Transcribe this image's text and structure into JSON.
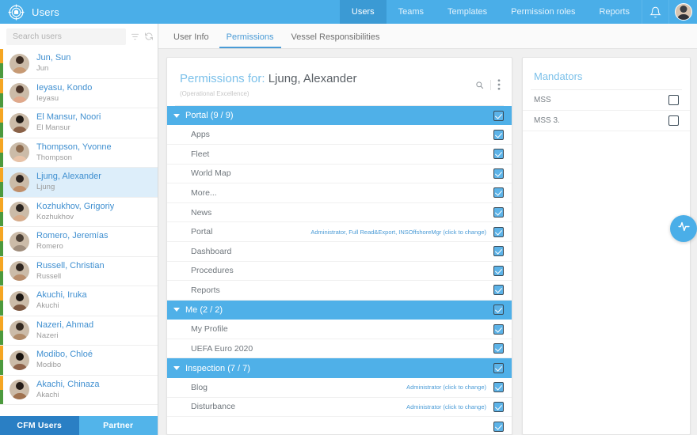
{
  "header": {
    "logo_icon": "compass-logo-icon",
    "title": "Users",
    "nav": [
      {
        "label": "Users",
        "active": true
      },
      {
        "label": "Teams",
        "active": false
      },
      {
        "label": "Templates",
        "active": false
      },
      {
        "label": "Permission roles",
        "active": false
      },
      {
        "label": "Reports",
        "active": false
      }
    ],
    "bell_icon": "notification-bell-icon",
    "avatar_icon": "user-avatar"
  },
  "sidebar": {
    "search": {
      "placeholder": "Search users",
      "value": ""
    },
    "tools": [
      {
        "icon": "filter-icon",
        "name": "filter-button"
      },
      {
        "icon": "refresh-icon",
        "name": "refresh-button"
      },
      {
        "icon": "plus-icon",
        "name": "add-user-button"
      }
    ],
    "users": [
      {
        "name": "Jun, Sun",
        "sub": "Jun",
        "selected": false,
        "skin": "#c79a74",
        "hair": "#3a2b22"
      },
      {
        "name": "Ieyasu, Kondo",
        "sub": "Ieyasu",
        "selected": false,
        "skin": "#e0a98c",
        "hair": "#4a352a"
      },
      {
        "name": "El Mansur, Noori",
        "sub": "El Mansur",
        "selected": false,
        "skin": "#8a6248",
        "hair": "#1f1a16"
      },
      {
        "name": "Thompson, Yvonne",
        "sub": "Thompson",
        "selected": false,
        "skin": "#e8c3a8",
        "hair": "#8c6b4f"
      },
      {
        "name": "Ljung, Alexander",
        "sub": "Ljung",
        "selected": true,
        "skin": "#c08f6a",
        "hair": "#2b2320"
      },
      {
        "name": "Kozhukhov, Grigoriy",
        "sub": "Kozhukhov",
        "selected": false,
        "skin": "#d7ac8b",
        "hair": "#2a2420"
      },
      {
        "name": "Romero, Jeremías",
        "sub": "Romero",
        "selected": false,
        "skin": "#9f8d7c",
        "hair": "#4b4036"
      },
      {
        "name": "Russell, Christian",
        "sub": "Russell",
        "selected": false,
        "skin": "#b98e6c",
        "hair": "#2f2620"
      },
      {
        "name": "Akuchi, Iruka",
        "sub": "Akuchi",
        "selected": false,
        "skin": "#7c5740",
        "hair": "#1b1613"
      },
      {
        "name": "Nazeri, Ahmad",
        "sub": "Nazeri",
        "selected": false,
        "skin": "#b08a68",
        "hair": "#342a22"
      },
      {
        "name": "Modibo, Chloé",
        "sub": "Modibo",
        "selected": false,
        "skin": "#8e6249",
        "hair": "#17120f"
      },
      {
        "name": "Akachi, Chinaza",
        "sub": "Akachi",
        "selected": false,
        "skin": "#a0724f",
        "hair": "#241c17"
      }
    ],
    "bottom_tabs": [
      {
        "label": "CFM Users",
        "active": true
      },
      {
        "label": "Partner",
        "active": false
      }
    ]
  },
  "content": {
    "tabs": [
      {
        "label": "User Info",
        "active": false
      },
      {
        "label": "Permissions",
        "active": true
      },
      {
        "label": "Vessel Responsibilities",
        "active": false
      }
    ],
    "permissions_panel": {
      "title_prefix": "Permissions for:",
      "title_user": "Ljung, Alexander",
      "subtitle": "(Operational Excellence)",
      "search_icon": "search-icon",
      "menu_icon": "kebab-menu-icon",
      "groups": [
        {
          "label": "Portal (9 / 9)",
          "checked": true,
          "expanded": true,
          "items": [
            {
              "label": "Apps",
              "note": "",
              "checked": true
            },
            {
              "label": "Fleet",
              "note": "",
              "checked": true
            },
            {
              "label": "World Map",
              "note": "",
              "checked": true
            },
            {
              "label": "More...",
              "note": "",
              "checked": true
            },
            {
              "label": "News",
              "note": "",
              "checked": true
            },
            {
              "label": "Portal",
              "note": "Administrator, Full Read&Export, INSOffshoreMgr (click to change)",
              "checked": true
            },
            {
              "label": "Dashboard",
              "note": "",
              "checked": true
            },
            {
              "label": "Procedures",
              "note": "",
              "checked": true
            },
            {
              "label": "Reports",
              "note": "",
              "checked": true
            }
          ]
        },
        {
          "label": "Me (2 / 2)",
          "checked": true,
          "expanded": true,
          "items": [
            {
              "label": "My Profile",
              "note": "",
              "checked": true
            },
            {
              "label": "UEFA Euro 2020",
              "note": "",
              "checked": true
            }
          ]
        },
        {
          "label": "Inspection (7 / 7)",
          "checked": true,
          "expanded": true,
          "items": [
            {
              "label": "Blog",
              "note": "Administrator (click to change)",
              "checked": true
            },
            {
              "label": "Disturbance",
              "note": "Administrator (click to change)",
              "checked": true
            }
          ]
        }
      ]
    },
    "mandators_panel": {
      "title": "Mandators",
      "rows": [
        {
          "label": "MSS",
          "checked": false
        },
        {
          "label": "MSS 3.",
          "checked": false
        }
      ]
    }
  },
  "fab": {
    "icon": "activity-pulse-icon"
  },
  "colors": {
    "brand_blue": "#4aaee8",
    "active_nav_blue": "#3b9ad4",
    "group_header_blue": "#4fb0e8",
    "link_blue": "#4a9bd6",
    "selected_row": "#ddeefa",
    "stripe_orange": "#f5a623",
    "stripe_green": "#4c9a3e"
  }
}
